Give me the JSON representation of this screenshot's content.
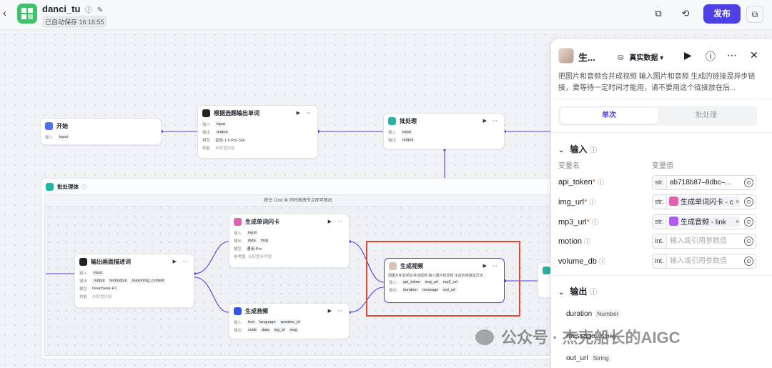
{
  "header": {
    "app_name": "danci_tu",
    "autosave": "已自动保存 16:16:55",
    "publish_label": "发布"
  },
  "canvas": {
    "hint": "按住 Cmd ⌘ 同时拖拽节点即可拖出",
    "group_title": "批处理体",
    "nodes": {
      "start": {
        "title": "开始",
        "in_k": "输入",
        "in_v": "input"
      },
      "gen_words": {
        "title": "根据选题输出单词",
        "r1k": "输入",
        "r1v": "input",
        "r2k": "输出",
        "r2v": "output",
        "r3k": "模型",
        "r3v": "豆包·1.5·Pro·32k",
        "r4k": "技能",
        "r4v": "未配置技能"
      },
      "batch": {
        "title": "批处理",
        "r1k": "输入",
        "r1v": "input",
        "r2k": "输出",
        "r2v": "output"
      },
      "scene": {
        "title": "输出画面描述词",
        "r1k": "输入",
        "r1v": "input",
        "r2k": "输出",
        "r2v1": "output",
        "r2v2": "textoutput",
        "r2v3": "reasoning_content",
        "r3k": "模型",
        "r3v": "DeepSeek-R1",
        "r4k": "技能",
        "r4v": "未配置技能"
      },
      "card": {
        "title": "生成单词闪卡",
        "r1k": "输入",
        "r1v": "input",
        "r2k": "输出",
        "r2v1": "data",
        "r2v2": "msg",
        "r3k": "模型",
        "r3v": "通用-Pro",
        "r4k": "参考图",
        "r4v": "未配置参考图"
      },
      "audio": {
        "title": "生成音频",
        "r1k": "输入",
        "r1v1": "text",
        "r1v2": "language",
        "r1v3": "speaker_id",
        "r2k": "输出",
        "r2v1": "code",
        "r2v2": "data",
        "r2v3": "log_id",
        "r2v4": "msg"
      },
      "video": {
        "title": "生成视频",
        "desc": "把图片和音频合并成视频 输入图片和音频 生成的链接是异步…",
        "r1k": "输入",
        "r1v1": "api_token",
        "r1v2": "img_url",
        "r1v3": "mp3_url",
        "r2k": "输出",
        "r2v1": "duration",
        "r2v2": "message",
        "r2v3": "out_url"
      }
    }
  },
  "panel": {
    "title": "生...",
    "mode": "真实数据",
    "description": "把图片和音频合并成视频 输入图片和音频 生成的链接是异步链接，要等待一定时间才能用，请不要用这个链接放在后...",
    "tabs": [
      "单次",
      "批处理"
    ],
    "input_section": "输入",
    "col_name": "变量名",
    "col_value": "变量值",
    "inputs": [
      {
        "name": "api_token",
        "required": "*",
        "type": "str.",
        "value": "ab718b87–8dbc–..."
      },
      {
        "name": "img_url",
        "required": "*",
        "type": "str.",
        "value": "生成单词闪卡 - c"
      },
      {
        "name": "mp3_url",
        "required": "*",
        "type": "str.",
        "value": "生成音频 - link"
      },
      {
        "name": "motion",
        "required": "",
        "type": "int.",
        "placeholder": "输入或引用参数值"
      },
      {
        "name": "volume_db",
        "required": "",
        "type": "int.",
        "placeholder": "输入或引用参数值"
      }
    ],
    "output_section": "输出",
    "outputs": [
      {
        "name": "duration",
        "type": "Number"
      },
      {
        "name": "message",
        "type": "String"
      },
      {
        "name": "out_url",
        "type": "String"
      }
    ]
  },
  "watermark": "公众号 · 杰克船长的AIGC",
  "colors": {
    "accent": "#4e40e5",
    "highlight": "#e4482f",
    "logo": "#3ec46a"
  }
}
